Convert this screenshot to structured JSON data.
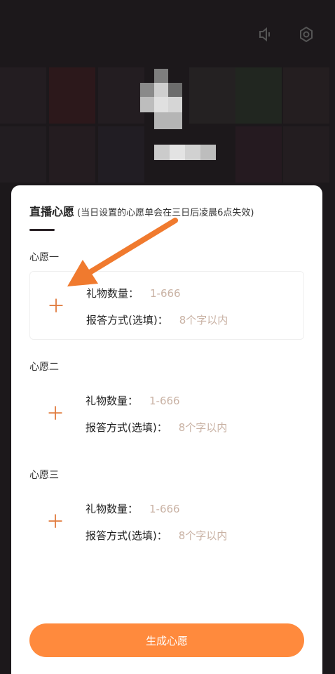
{
  "background": {
    "volume_icon": "volume-icon",
    "settings_icon": "gear-icon"
  },
  "sheet": {
    "title": "直播心愿",
    "subtitle": "(当日设置的心愿单会在三日后凌晨6点失效)",
    "wishes": [
      {
        "label": "心愿一",
        "gift_count_label": "礼物数量：",
        "gift_count_placeholder": "1-666",
        "reply_label": "报答方式(选填)：",
        "reply_placeholder": "8个字以内"
      },
      {
        "label": "心愿二",
        "gift_count_label": "礼物数量：",
        "gift_count_placeholder": "1-666",
        "reply_label": "报答方式(选填)：",
        "reply_placeholder": "8个字以内"
      },
      {
        "label": "心愿三",
        "gift_count_label": "礼物数量：",
        "gift_count_placeholder": "1-666",
        "reply_label": "报答方式(选填)：",
        "reply_placeholder": "8个字以内"
      }
    ],
    "submit_label": "生成心愿",
    "accent_color": "#ff8a3d"
  }
}
